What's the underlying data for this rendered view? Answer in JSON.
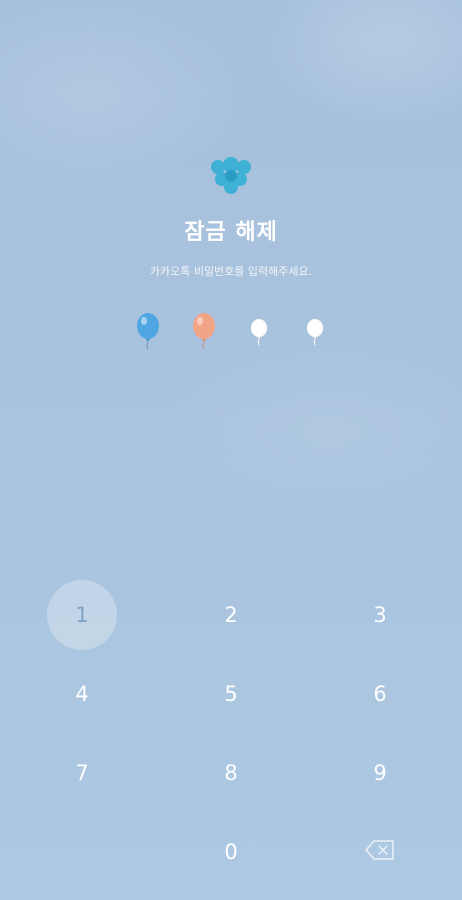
{
  "screen": {
    "title": "잠금 해제",
    "subtitle": "카카오톡 비밀번호를 입력해주세요."
  },
  "pin_indicators": [
    {
      "state": "filled",
      "color": "#4fa6e3"
    },
    {
      "state": "filled",
      "color": "#f2a486"
    },
    {
      "state": "empty",
      "color": "#ffffff"
    },
    {
      "state": "empty",
      "color": "#ffffff"
    }
  ],
  "keypad": {
    "keys": [
      "1",
      "2",
      "3",
      "4",
      "5",
      "6",
      "7",
      "8",
      "9",
      "0"
    ],
    "pressed_key": "1",
    "backspace_icon": "backspace-icon"
  },
  "logo_icon": "balloon-cluster-icon"
}
